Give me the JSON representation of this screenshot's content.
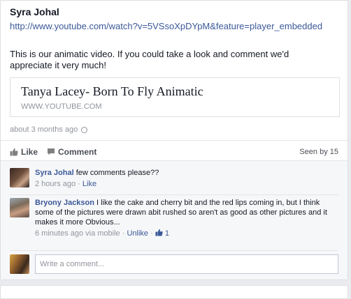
{
  "post": {
    "author": "Syra Johal",
    "link": "http://www.youtube.com/watch?v=5VSsoXpDYpM&feature=player_embedded",
    "message": "This is our animatic video. If you could take a look and comment we'd appreciate it very much!",
    "preview": {
      "title": "Tanya Lacey- Born To Fly Animatic",
      "domain": "WWW.YOUTUBE.COM"
    },
    "timestamp": "about 3 months ago"
  },
  "actions": {
    "like": "Like",
    "comment": "Comment",
    "seen_by": "Seen by 15"
  },
  "comments": [
    {
      "name": "Syra Johal",
      "text": "few comments please??",
      "time": "2 hours ago",
      "sep": "·",
      "like": "Like"
    },
    {
      "name": "Bryony Jackson",
      "text": "I like the cake and cherry bit and the red lips coming in, but I think some of the pictures were drawn abit rushed so aren't as good as other pictures and it makes it more Obvious...",
      "time": "6 minutes ago via mobile",
      "sep": "·",
      "unlike": "Unlike",
      "sep2": "·",
      "like_count": "1"
    }
  ],
  "write_comment": {
    "placeholder": "Write a comment..."
  },
  "colors": {
    "link": "#3b5998",
    "meta": "#90949c",
    "comments_bg": "#f6f7f9"
  }
}
